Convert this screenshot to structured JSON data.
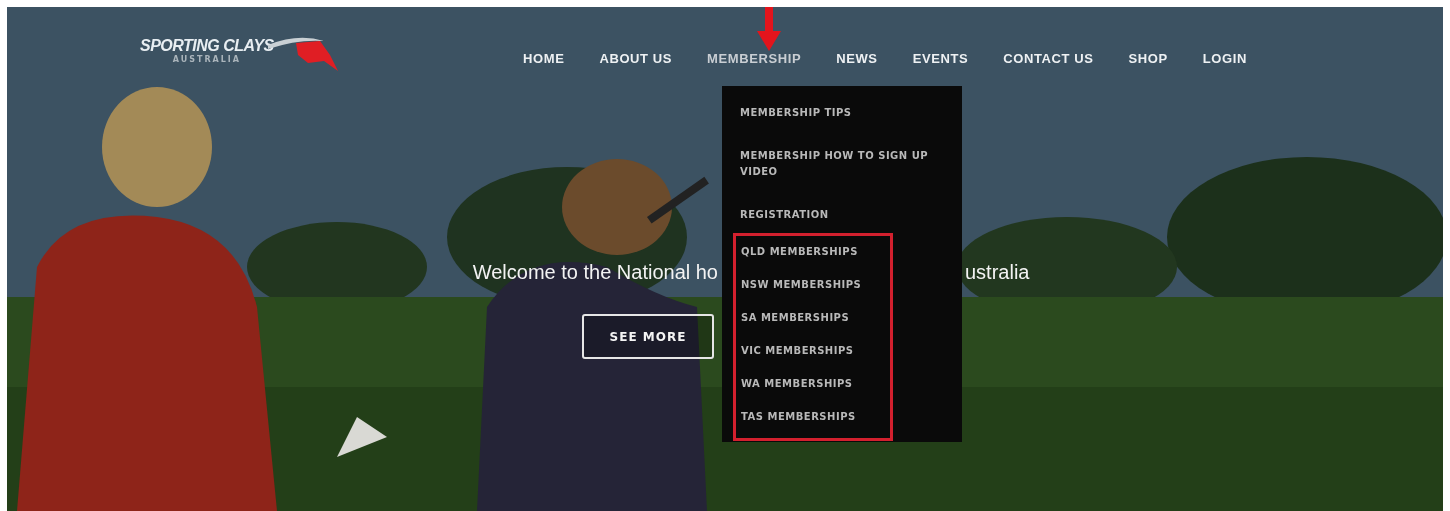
{
  "logo": {
    "title": "SPORTING CLAYS",
    "subtitle": "AUSTRALIA"
  },
  "nav": [
    {
      "label": "HOME",
      "selected": false
    },
    {
      "label": "ABOUT US",
      "selected": false
    },
    {
      "label": "MEMBERSHIP",
      "selected": true
    },
    {
      "label": "NEWS",
      "selected": false
    },
    {
      "label": "EVENTS",
      "selected": false
    },
    {
      "label": "CONTACT US",
      "selected": false
    },
    {
      "label": "SHOP",
      "selected": false
    },
    {
      "label": "LOGIN",
      "selected": false
    }
  ],
  "dropdown": {
    "items": [
      "MEMBERSHIP TIPS",
      "MEMBERSHIP HOW TO SIGN UP VIDEO",
      "REGISTRATION"
    ],
    "highlighted_items": [
      "QLD MEMBERSHIPS",
      "NSW MEMBERSHIPS",
      "SA MEMBERSHIPS",
      "VIC MEMBERSHIPS",
      "WA MEMBERSHIPS",
      "TAS MEMBERSHIPS"
    ]
  },
  "hero": {
    "headline_left": "Welcome to the National ho",
    "headline_right": "ustralia",
    "button": "SEE MORE"
  }
}
